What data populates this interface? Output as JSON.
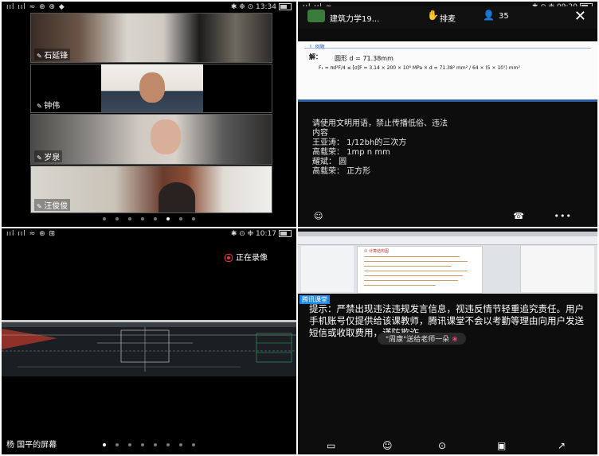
{
  "panel1": {
    "status_left": "ııl ııl ≈ ⊕ ⊕ ◆",
    "status_right": "✱ ❉ ⊙ 13:34",
    "participants": [
      "石延锋",
      "钟伟",
      "岁泉",
      "汪俊俊"
    ]
  },
  "panel2": {
    "status_right": "✱ ⊙ ❉ 09:20",
    "course_title": "建筑力学19...",
    "raise_hand": "排麦",
    "viewer_count": "35",
    "doc_heading": "1. 例题",
    "doc_solution": "解：",
    "doc_formula_1": "圆形  d = 71.38mm",
    "doc_formula_2": "F₁ = πd²F/4 ≤ [σ]F = 3.14 × 200 × 10⁶ MPa × d = 71.38² mm² / 64 × (5 × 10⁷) mm²",
    "chat_lines": [
      "请使用文明用语，禁止传播低俗、违法",
      "内容",
      "王亚涛：  1/12bh的三次方",
      "高载荣：  1mp n mm",
      "耀斌：  圆",
      "高载荣：  正方形"
    ],
    "footer_left": "☺",
    "footer_phone": "☎",
    "footer_more": "•••"
  },
  "panel3": {
    "status_left": "ııl ııl ≈ ⊕ ⊞",
    "status_right": "✱ ⊙ ❉ 10:17",
    "recording_label": "正在录像",
    "screen_owner": "杨   国平的屏幕"
  },
  "panel4": {
    "status_right": "✱ ⊙ 09:20",
    "doc_title": "① 计算结构图",
    "source_tag": "腾讯课堂",
    "notice": "提示：严禁出现违法违规发言信息，视违反情节轻重追究责任。用户手机账号仅提供给该课教师，腾讯课堂不会以考勤等理由向用户发送短信或收取费用，谨防欺诈。",
    "gift_text": "\"周康\"送给老师一朵",
    "gift_icon": "❀",
    "footer_icons": [
      "▭",
      "☺",
      "⊙",
      "▣",
      "↗"
    ]
  },
  "colors": {
    "accent_blue": "#1e88e5",
    "record_red": "#e33333"
  }
}
